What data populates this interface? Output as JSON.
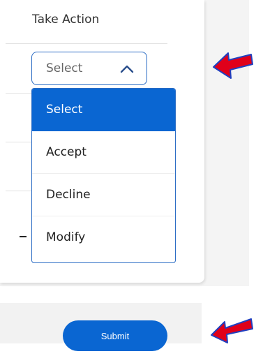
{
  "panel": {
    "header": "Take Action"
  },
  "select": {
    "value": "Select",
    "expanded": true,
    "chevron_icon": "chevron-up-icon"
  },
  "dropdown": {
    "options": [
      {
        "label": "Select",
        "selected": true
      },
      {
        "label": "Accept",
        "selected": false
      },
      {
        "label": "Decline",
        "selected": false
      },
      {
        "label": "Modify",
        "selected": false
      }
    ]
  },
  "footer": {
    "submit_label": "Submit"
  },
  "colors": {
    "accent": "#0a66d2",
    "border_accent": "#2b6cc4",
    "annotation_arrow": "#e0001a",
    "annotation_outline": "#2040c0"
  },
  "annotations": {
    "arrow_icon": "red-pointer-arrow-icon"
  }
}
